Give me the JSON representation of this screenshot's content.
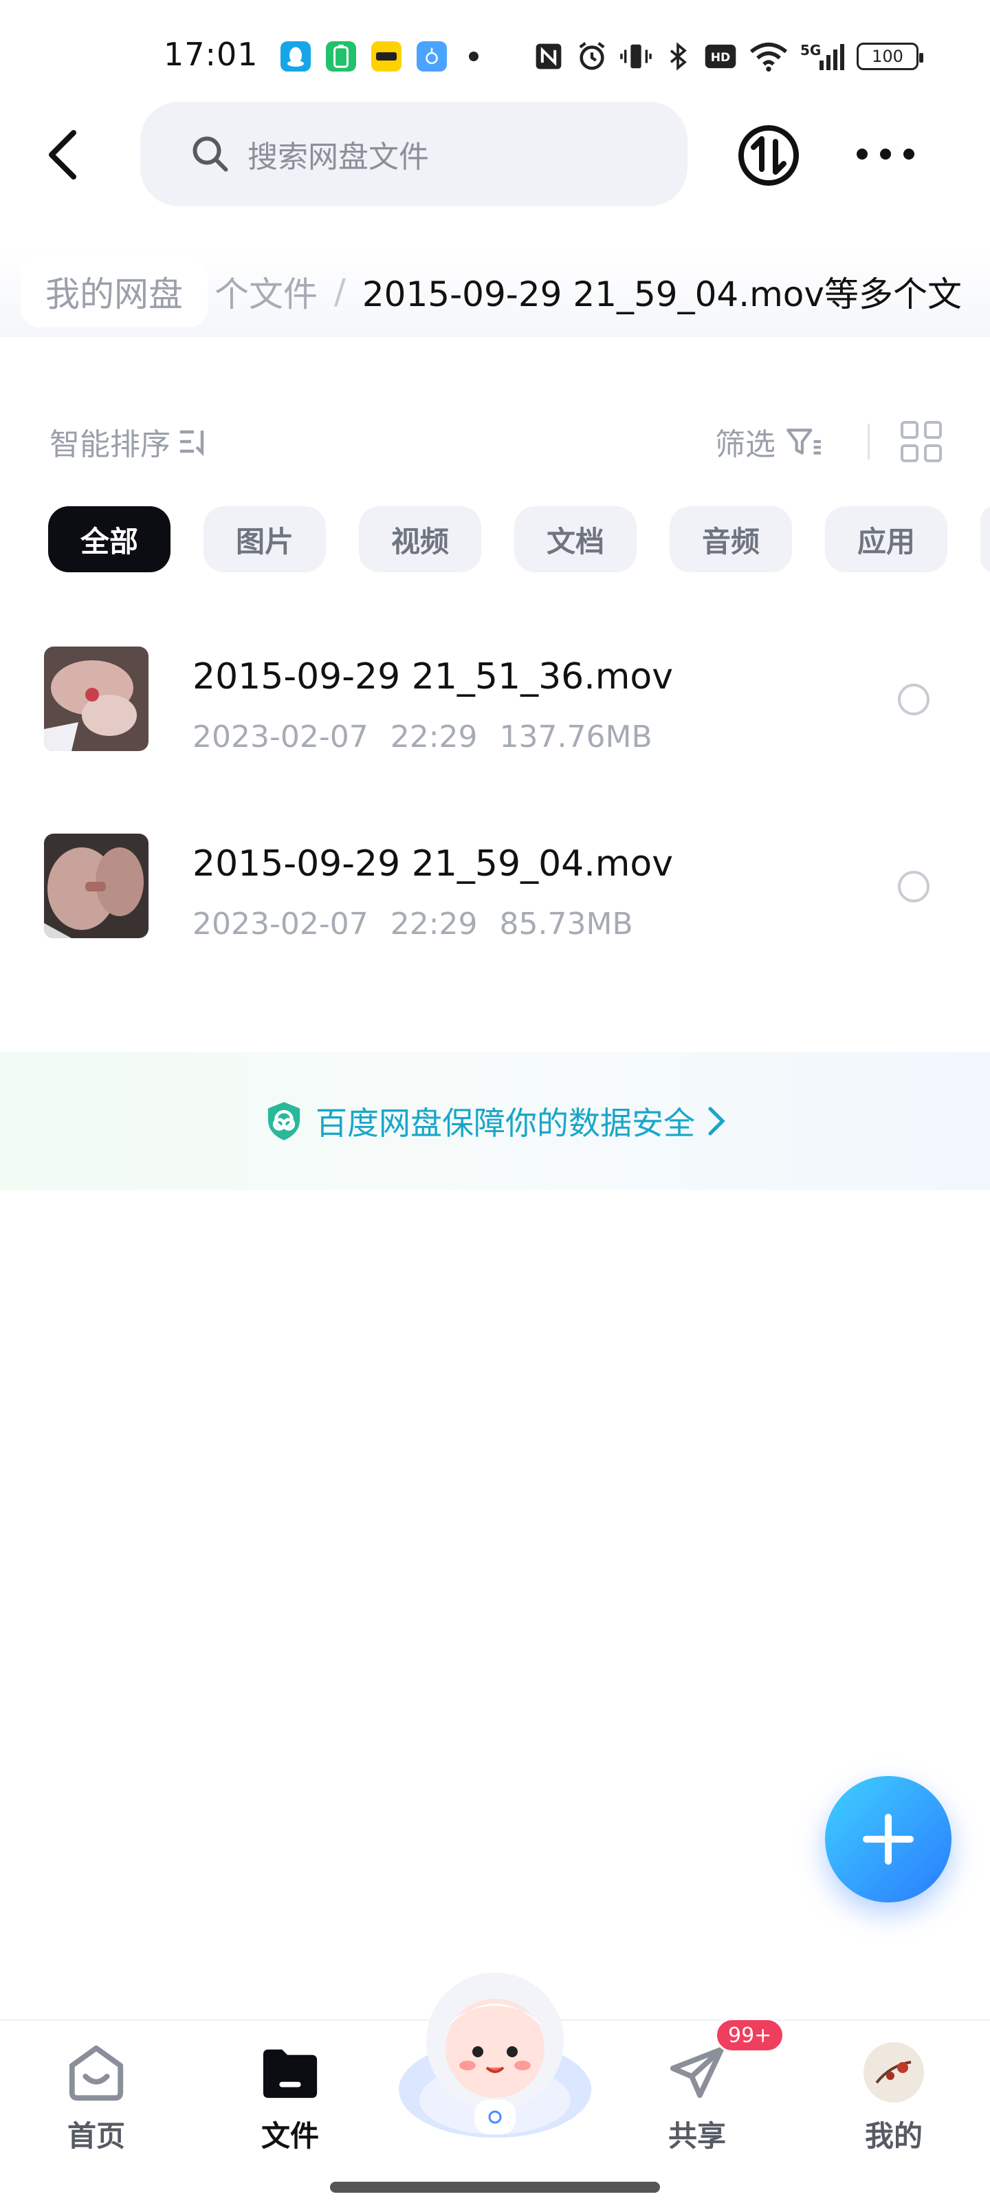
{
  "status_bar": {
    "time": "17:01",
    "battery": "100"
  },
  "header": {
    "search_placeholder": "搜索网盘文件"
  },
  "breadcrumb": {
    "root": "我的网盘",
    "middle": "个文件",
    "current": "2015-09-29 21_59_04.mov等多个文"
  },
  "toolbar": {
    "sort_label": "智能排序",
    "filter_label": "筛选"
  },
  "tabs": [
    {
      "label": "全部",
      "active": true
    },
    {
      "label": "图片"
    },
    {
      "label": "视频"
    },
    {
      "label": "文档"
    },
    {
      "label": "音频"
    },
    {
      "label": "应用"
    }
  ],
  "files": [
    {
      "name": "2015-09-29 21_51_36.mov",
      "date": "2023-02-07",
      "time": "22:29",
      "size": "137.76MB"
    },
    {
      "name": "2015-09-29 21_59_04.mov",
      "date": "2023-02-07",
      "time": "22:29",
      "size": "85.73MB"
    }
  ],
  "banner": {
    "text": "百度网盘保障你的数据安全"
  },
  "nav": {
    "home": "首页",
    "files": "文件",
    "share": "共享",
    "mine": "我的",
    "share_badge": "99+"
  },
  "colors": {
    "accent": "#2b7bff",
    "banner_text": "#1aa6c8",
    "badge": "#f03e5e"
  }
}
